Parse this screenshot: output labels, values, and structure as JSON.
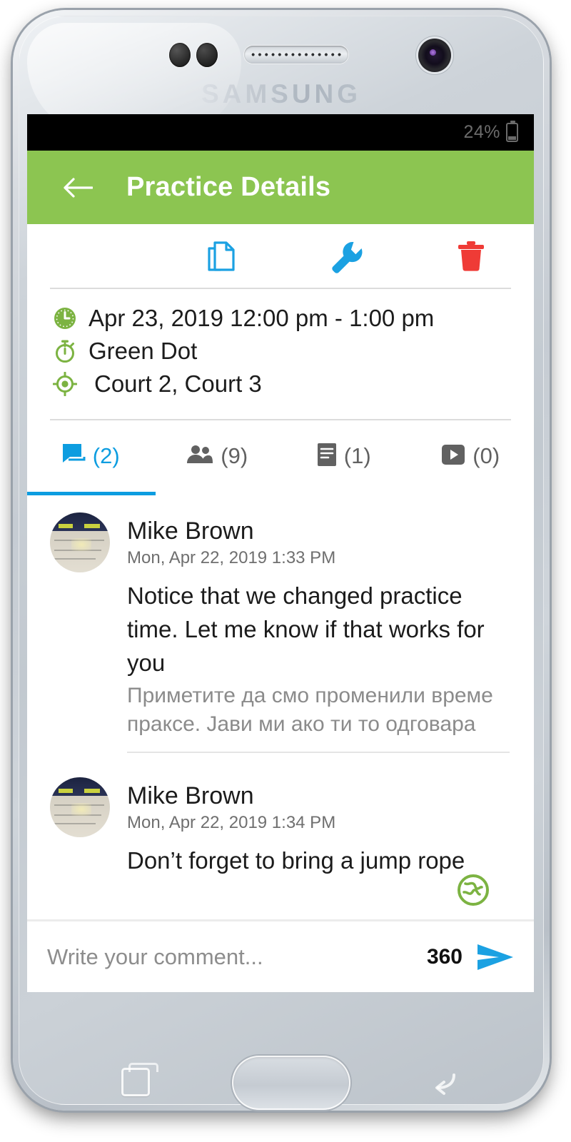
{
  "device": {
    "brand": "SAMSUNG"
  },
  "status_bar": {
    "battery_percent": "24%"
  },
  "app_bar": {
    "title": "Practice Details",
    "background_color": "#8cc551",
    "back_icon": "arrow-left-icon"
  },
  "action_toolbar": {
    "items": [
      {
        "name": "duplicate-button",
        "icon": "copy-document-icon",
        "color": "#1ba1e2"
      },
      {
        "name": "edit-button",
        "icon": "wrench-icon",
        "color": "#1ba1e2"
      },
      {
        "name": "delete-button",
        "icon": "trash-icon",
        "color": "#ef3b36"
      }
    ]
  },
  "details": {
    "datetime": "Apr 23, 2019 12:00 pm - 1:00 pm",
    "datetime_icon": "clock-icon",
    "group": "Green Dot",
    "group_icon": "stopwatch-icon",
    "location": "Court 2, Court 3",
    "location_icon": "target-location-icon",
    "icon_color": "#7cb342"
  },
  "tabs": {
    "active_color": "#0d9de0",
    "inactive_color": "#616161",
    "items": [
      {
        "name": "tab-comments",
        "icon": "comment-icon",
        "count": "(2)",
        "active": true
      },
      {
        "name": "tab-attendees",
        "icon": "people-icon",
        "count": "(9)",
        "active": false
      },
      {
        "name": "tab-notes",
        "icon": "document-lines-icon",
        "count": "(1)",
        "active": false
      },
      {
        "name": "tab-videos",
        "icon": "video-play-icon",
        "count": "(0)",
        "active": false
      }
    ]
  },
  "comments": [
    {
      "author": "Mike Brown",
      "timestamp": "Mon, Apr 22, 2019 1:33 PM",
      "body": "Notice that we changed practice time. Let me know if that works for you",
      "translation": "Приметите да смо променили време праксе. Јави ми ако ти то одговара"
    },
    {
      "author": "Mike Brown",
      "timestamp": "Mon, Apr 22, 2019 1:34 PM",
      "body": "Don’t forget to bring a jump rope",
      "translation": ""
    }
  ],
  "translate_badge": {
    "icon": "globe-translate-icon",
    "color": "#7cb342"
  },
  "comment_input": {
    "placeholder": "Write your comment...",
    "value": "",
    "char_counter": "360",
    "send_icon": "send-arrow-icon",
    "send_color": "#1ba1e2"
  }
}
